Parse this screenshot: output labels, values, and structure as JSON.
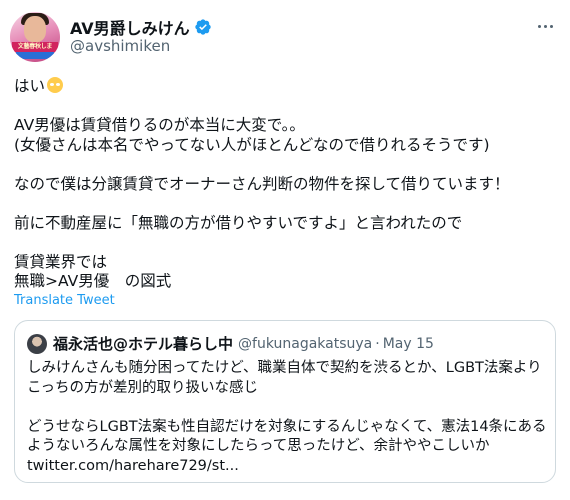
{
  "tweet": {
    "display_name": "AV男爵しみけん",
    "handle": "@avshimiken",
    "avatar_banner_text": "文藝春秋しま",
    "verified": true,
    "lines": [
      "はい",
      "",
      "AV男優は賃貸借りるのが本当に大変で。。",
      "(女優さんは本名でやってない人がほとんどなので借りれるそうです)",
      "",
      "なので僕は分譲賃貸でオーナーさん判断の物件を探して借りています！",
      "",
      "前に不動産屋に「無職の方が借りやすいですよ」と言われたので",
      "",
      "賃貸業界では",
      "無職>AV男優　の図式"
    ],
    "first_line_emoji": "rolling-eyes-emoji",
    "translate_label": "Translate Tweet"
  },
  "quote": {
    "display_name": "福永活也@ホテル暮らし中",
    "handle": "@fukunagakatsuya",
    "separator": "·",
    "date": "May 15",
    "lines": [
      "しみけんさんも随分困ってたけど、職業自体で契約を渋るとか、LGBT法案より",
      "こっちの方が差別的取り扱いな感じ",
      "",
      "どうせならLGBT法案も性自認だけを対象にするんじゃなくて、憲法14条にある",
      "ようないろんな属性を対象にしたらって思ったけど、余計ややこしいか",
      "twitter.com/harehare729/st..."
    ]
  },
  "colors": {
    "text": "#0f1419",
    "secondary": "#536471",
    "link": "#1d9bf0",
    "border": "#cfd9de",
    "verified": "#1d9bf0"
  }
}
